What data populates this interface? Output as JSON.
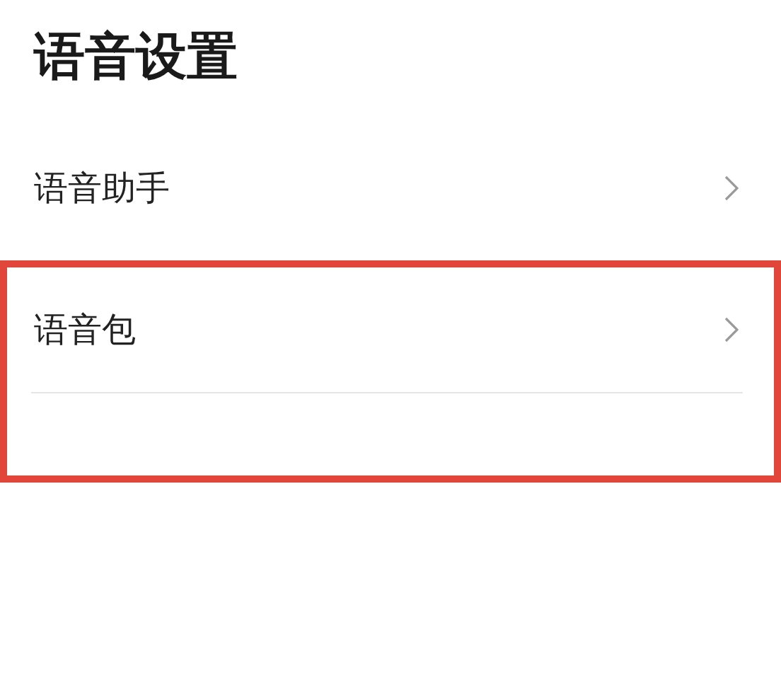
{
  "title": "语音设置",
  "items": [
    {
      "label": "语音助手",
      "highlighted": false
    },
    {
      "label": "语音包",
      "highlighted": true
    }
  ]
}
